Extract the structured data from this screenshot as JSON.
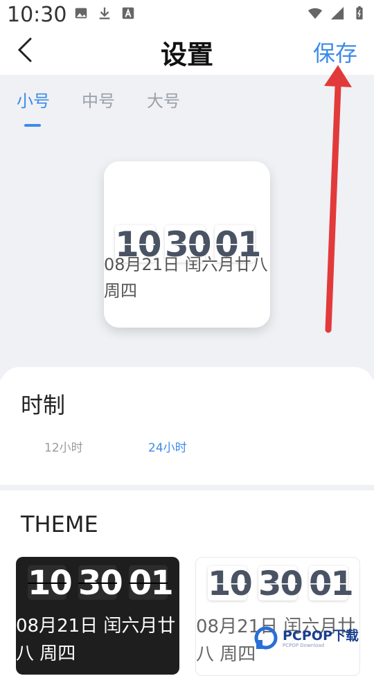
{
  "status_bar": {
    "time": "10:30",
    "left_icons": [
      "image-icon",
      "download-icon",
      "font-icon"
    ],
    "right_icons": [
      "wifi-icon",
      "signal-icon",
      "battery-icon"
    ]
  },
  "header": {
    "title": "设置",
    "save_label": "保存"
  },
  "size_tabs": [
    {
      "label": "小号",
      "active": true
    },
    {
      "label": "中号",
      "active": false
    },
    {
      "label": "大号",
      "active": false
    }
  ],
  "preview": {
    "hours": "10",
    "minutes": "30",
    "seconds": "01",
    "date_line": "08月21日 闰六月廿八 周四"
  },
  "hour_format": {
    "title": "时制",
    "options": [
      "12小时",
      "24小时"
    ],
    "selected": "24小时"
  },
  "theme": {
    "title": "THEME",
    "cards": [
      {
        "style": "dark",
        "hours": "10",
        "minutes": "30",
        "seconds": "01",
        "date_line": "08月21日 闰六月廿八 周四"
      },
      {
        "style": "light",
        "hours": "10",
        "minutes": "30",
        "seconds": "01",
        "date_line": "08月21日 闰六月廿八 周四"
      }
    ]
  },
  "watermark": {
    "text": "PCPOP下载",
    "sub": "PCPOP Download"
  },
  "colors": {
    "accent": "#3d8be8",
    "preview_bg": "#eff1f5",
    "arrow": "#e23a3a",
    "digit_text": "#4a5363"
  }
}
